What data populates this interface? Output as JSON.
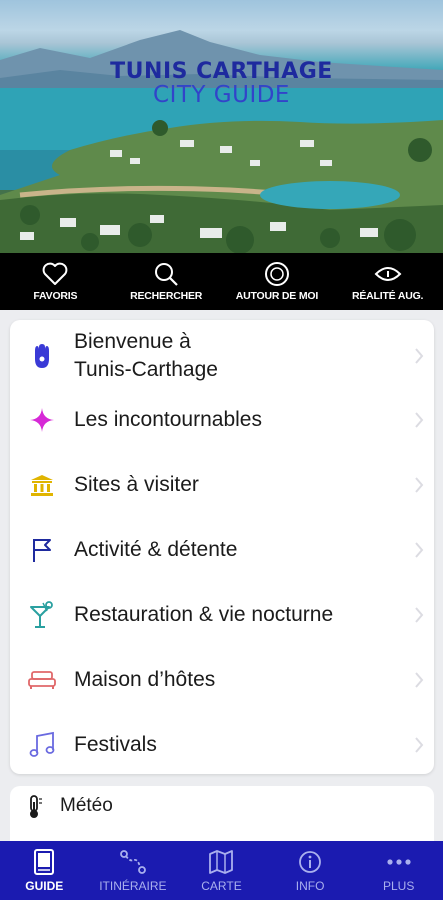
{
  "hero": {
    "title_line1": "TUNIS CARTHAGE",
    "title_line2": "CITY GUIDE"
  },
  "toolbar": {
    "items": [
      {
        "label": "FAVORIS",
        "icon": "heart-icon"
      },
      {
        "label": "RECHERCHER",
        "icon": "search-icon"
      },
      {
        "label": "AUTOUR DE MOI",
        "icon": "compass-icon"
      },
      {
        "label": "RÉALITÉ AUG.",
        "icon": "eye-icon"
      }
    ]
  },
  "menu": {
    "items": [
      {
        "label": "Bienvenue à\nTunis-Carthage",
        "icon": "hamsa-hand-icon",
        "color": "#3a3ad6"
      },
      {
        "label": "Les incontournables",
        "icon": "sparkle-star-icon",
        "color": "#d629d6"
      },
      {
        "label": "Sites à visiter",
        "icon": "monument-icon",
        "color": "#e0b400"
      },
      {
        "label": "Activité & détente",
        "icon": "flag-icon",
        "color": "#1e2a9e"
      },
      {
        "label": "Restauration & vie nocturne",
        "icon": "cocktail-glass-icon",
        "color": "#2aa0a0"
      },
      {
        "label": "Maison d’hôtes",
        "icon": "bed-icon",
        "color": "#e0686a"
      },
      {
        "label": "Festivals",
        "icon": "music-note-icon",
        "color": "#6a6ae0"
      }
    ]
  },
  "meteo": {
    "label": "Météo",
    "icon": "thermometer-icon"
  },
  "bottom_nav": {
    "items": [
      {
        "label": "GUIDE",
        "icon": "book-icon",
        "active": true
      },
      {
        "label": "ITINÉRAIRE",
        "icon": "route-icon",
        "active": false
      },
      {
        "label": "CARTE",
        "icon": "map-icon",
        "active": false
      },
      {
        "label": "INFO",
        "icon": "info-icon",
        "active": false
      },
      {
        "label": "PLUS",
        "icon": "more-dots-icon",
        "active": false
      }
    ]
  },
  "colors": {
    "brand_blue": "#1b1bb0",
    "title_blue": "#1e2a9e",
    "toolbar_bg": "#000000"
  }
}
